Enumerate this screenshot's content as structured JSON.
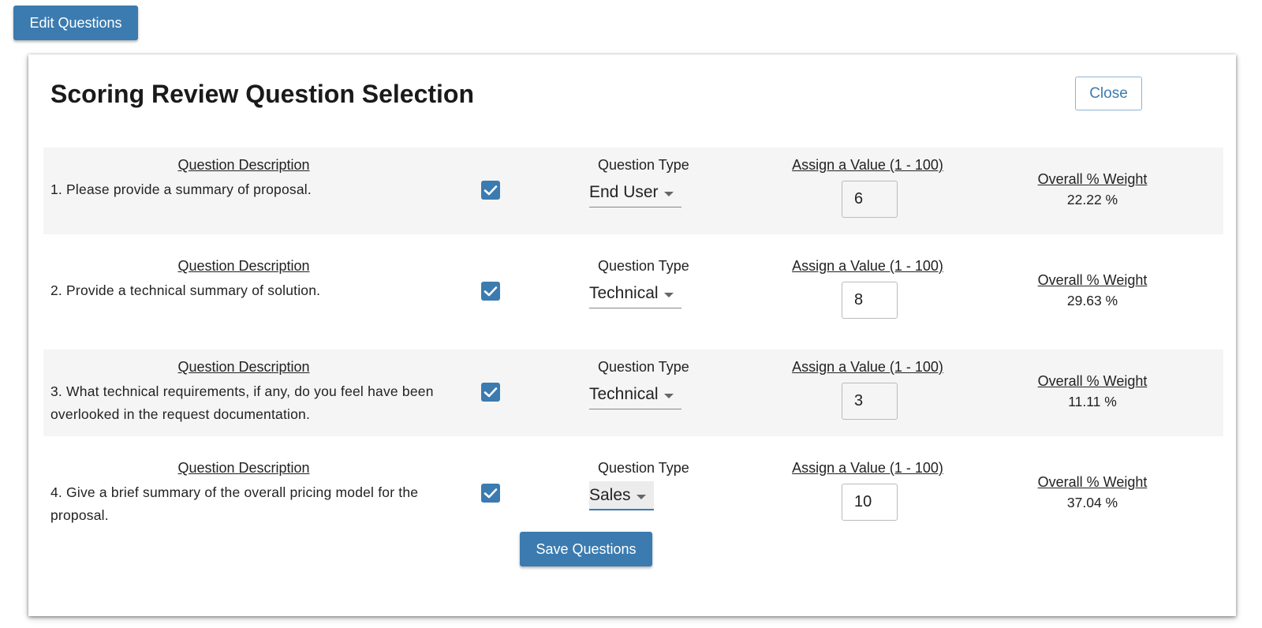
{
  "edit_button_label": "Edit Questions",
  "modal": {
    "title": "Scoring Review Question Selection",
    "close_label": "Close",
    "save_label": "Save Questions",
    "column_labels": {
      "description": "Question Description",
      "type": "Question Type",
      "value": "Assign a Value (1 - 100)",
      "weight": "Overall % Weight"
    },
    "questions": [
      {
        "text": "1. Please provide a summary of proposal.",
        "checked": true,
        "type": "End User",
        "value": "6",
        "weight": "22.22 %"
      },
      {
        "text": "2. Provide a technical summary of solution.",
        "checked": true,
        "type": "Technical",
        "value": "8",
        "weight": "29.63 %"
      },
      {
        "text": "3. What technical requirements, if any, do you feel have been overlooked in the request documentation.",
        "checked": true,
        "type": "Technical",
        "value": "3",
        "weight": "11.11 %"
      },
      {
        "text": "4. Give a brief summary of the overall pricing model for the proposal.",
        "checked": true,
        "type": "Sales",
        "value": "10",
        "weight": "37.04 %"
      }
    ]
  },
  "icons": {
    "checkbox": "check-icon",
    "dropdown": "caret-down-icon"
  },
  "colors": {
    "primary": "#3b7bb0",
    "row_shade": "#f5f5f5"
  }
}
